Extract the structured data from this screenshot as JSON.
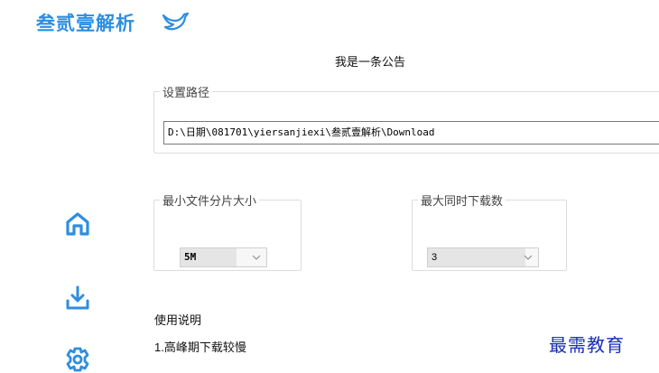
{
  "app": {
    "title": "叁贰壹解析",
    "brand_color": "#2d8ee0"
  },
  "notice": "我是一条公告",
  "settings": {
    "path_group_label": "设置路径",
    "path_value": "D:\\日期\\081701\\yiersanjiexi\\叁贰壹解析\\Download",
    "split_group_label": "最小文件分片大小",
    "split_selected": "5M",
    "download_group_label": "最大同时下载数",
    "download_selected": "3"
  },
  "sidebar": {
    "items": [
      {
        "icon": "home-icon"
      },
      {
        "icon": "download-icon"
      },
      {
        "icon": "settings-icon"
      }
    ]
  },
  "help": {
    "title": "使用说明",
    "lines": [
      "1.高峰期下载较慢"
    ]
  },
  "watermark": "最需教育"
}
